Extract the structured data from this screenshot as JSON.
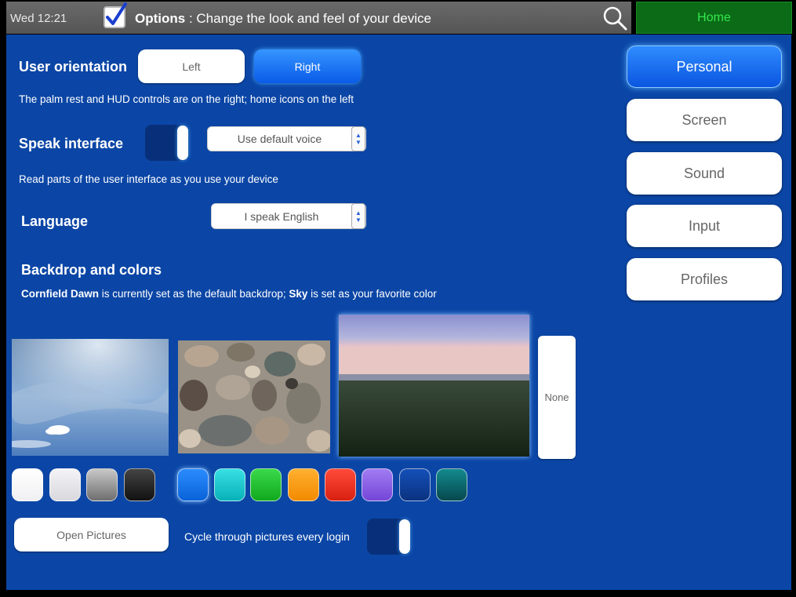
{
  "topbar": {
    "time": "Wed 12:21",
    "title_bold": "Options",
    "title_rest": " : Change the look and feel of your device",
    "home_label": "Home"
  },
  "orientation": {
    "label": "User orientation",
    "left_label": "Left",
    "right_label": "Right",
    "selected": "Right",
    "description": "The palm rest and HUD controls are on the right; home icons on the left"
  },
  "speak": {
    "label": "Speak interface",
    "toggle_on": true,
    "voice_value": "Use default voice",
    "description": "Read parts of the user interface as you use your device"
  },
  "language": {
    "label": "Language",
    "value": "I speak English"
  },
  "backdrop": {
    "label": "Backdrop and colors",
    "backdrop_name": "Cornfield Dawn",
    "desc_mid": " is currently set as the default backdrop; ",
    "favorite_color": "Sky",
    "desc_end": " is set as your favorite color",
    "pictures": [
      "sky",
      "pebbles",
      "cornfield-dawn"
    ],
    "none_label": "None",
    "swatches": [
      "#ffffff",
      "#e6e6ea",
      "#8a8a8a",
      "#1a1a1a",
      "#0a78f0",
      "#12c8cc",
      "#1ec42a",
      "#ff9a08",
      "#f03020",
      "#8a5ae8",
      "#0b3e9a",
      "#0e6a70"
    ],
    "open_pictures_label": "Open Pictures",
    "cycle_label": "Cycle through pictures every login",
    "cycle_on": true
  },
  "nav": {
    "items": [
      "Personal",
      "Screen",
      "Sound",
      "Input",
      "Profiles"
    ],
    "active": "Personal"
  },
  "colors": {
    "panel_bg": "#0b46a6",
    "accent": "#0a78f0",
    "home_bg": "#0b6b16",
    "home_text": "#36e650"
  }
}
